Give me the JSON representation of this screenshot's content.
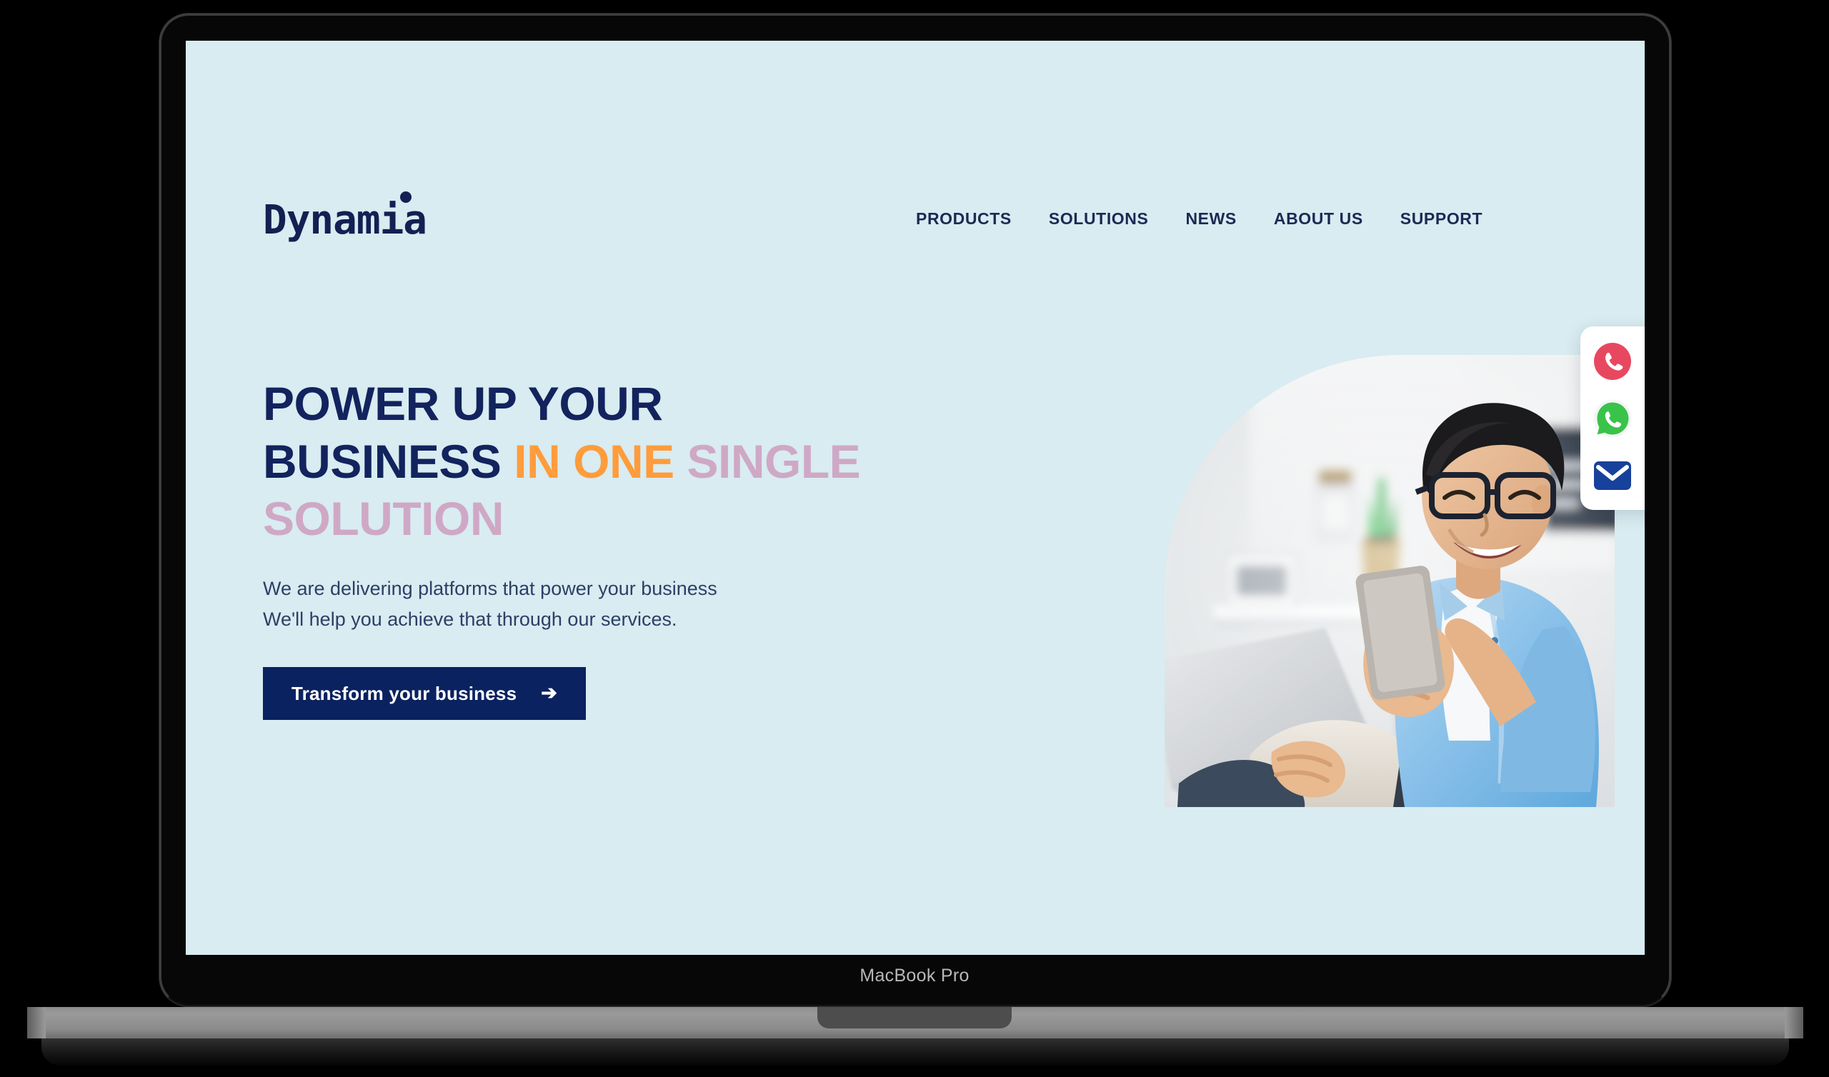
{
  "device": {
    "label": "MacBook Pro"
  },
  "site": {
    "brand": "Dynamia",
    "nav": [
      {
        "label": "PRODUCTS"
      },
      {
        "label": "SOLUTIONS"
      },
      {
        "label": "NEWS"
      },
      {
        "label": "ABOUT US"
      },
      {
        "label": "SUPPORT"
      }
    ]
  },
  "hero": {
    "headline": {
      "line1": "POWER UP YOUR",
      "line2_navy": "BUSINESS",
      "line2_orange": "IN ONE",
      "line2_mauve": "SINGLE",
      "line3_mauve": "SOLUTION"
    },
    "subtext_line1": "We are delivering platforms that power your business",
    "subtext_line2": "We'll help you achieve that through our services.",
    "cta_label": "Transform your business",
    "cta_arrow": "➔",
    "image_alt": "Smiling man with glasses in light blue shirt holding a phone while sitting with a laptop"
  },
  "contact_widget": {
    "items": [
      {
        "icon": "phone-icon",
        "name": "call",
        "color": "#e8485f"
      },
      {
        "icon": "whatsapp-icon",
        "name": "whatsapp",
        "color": "#3ac34a"
      },
      {
        "icon": "envelope-icon",
        "name": "email",
        "color": "#17429b"
      }
    ]
  },
  "colors": {
    "page_background": "#d8ecf1",
    "navy": "#12235e",
    "orange": "#ff9c3c",
    "mauve": "#cfa8c6",
    "cta_background": "#0a2260",
    "cta_text": "#ffffff",
    "body_text": "#2d3f66",
    "device_body": "#070707",
    "device_base": "#9a9a9a"
  }
}
